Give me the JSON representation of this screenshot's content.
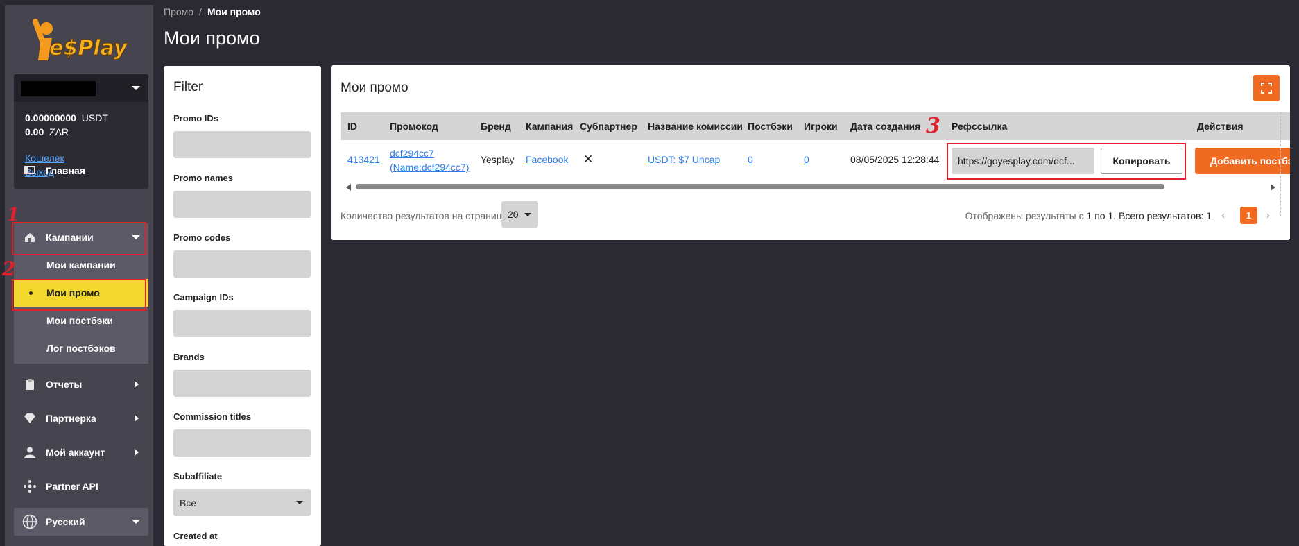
{
  "brand": {
    "logo_text": "Ye$Play"
  },
  "account": {
    "balance_usdt_value": "0.00000000",
    "balance_usdt_currency": "USDT",
    "balance_zar_value": "0.00",
    "balance_zar_currency": "ZAR",
    "wallet_link": "Кошелек",
    "logout_link": "Выход"
  },
  "sidebar": {
    "home": "Главная",
    "campaigns": "Кампании",
    "submenu": {
      "my_campaigns": "Мои кампании",
      "my_promo": "Мои промо",
      "my_postbacks": "Мои постбэки",
      "postback_log": "Лог постбэков"
    },
    "reports": "Отчеты",
    "partner": "Партнерка",
    "my_account": "Мой аккаунт",
    "partner_api": "Partner API",
    "language": "Русский"
  },
  "annotations": {
    "mark_1": "1",
    "mark_2": "2",
    "mark_3": "3"
  },
  "breadcrumb": {
    "parent": "Промо",
    "separator": "/",
    "current": "Мои промо"
  },
  "page_title": "Мои промо",
  "filter": {
    "title": "Filter",
    "promo_ids": "Promo IDs",
    "promo_names": "Promo names",
    "promo_codes": "Promo codes",
    "campaign_ids": "Campaign IDs",
    "brands": "Brands",
    "commission_titles": "Commission titles",
    "subaffiliate": "Subaffiliate",
    "subaffiliate_value": "Все",
    "created_at": "Created at"
  },
  "panel": {
    "title": "Мои промо",
    "columns": {
      "id": "ID",
      "promocode": "Промокод",
      "brand": "Бренд",
      "campaign": "Кампания",
      "subpartner": "Субпартнер",
      "commission": "Название комиссии",
      "postbacks": "Постбэки",
      "players": "Игроки",
      "created": "Дата создания",
      "reflink": "Рефссылка",
      "actions": "Действия"
    },
    "row": {
      "id": "413421",
      "promocode_line1": "dcf294cc7",
      "promocode_line2": "(Name:dcf294cc7)",
      "brand": "Yesplay",
      "campaign": "Facebook",
      "subpartner": "✕",
      "commission": "USDT: $7 Uncap",
      "postbacks": "0",
      "players": "0",
      "created": "08/05/2025 12:28:44",
      "reflink": "https://goyesplay.com/dcf...",
      "copy_button": "Копировать",
      "add_button": "Добавить постбэк"
    },
    "per_page_label": "Количество результатов на странице",
    "per_page_value": "20",
    "results_prefix": "Отображены результаты с",
    "results_range": "1 по 1. Всего результатов: 1",
    "current_page": "1",
    "prev": "‹",
    "next": "›"
  },
  "colors": {
    "accent": "#f06b22",
    "active": "#f1d72e",
    "annotation": "#e0202a",
    "link": "#2f7ee8"
  }
}
